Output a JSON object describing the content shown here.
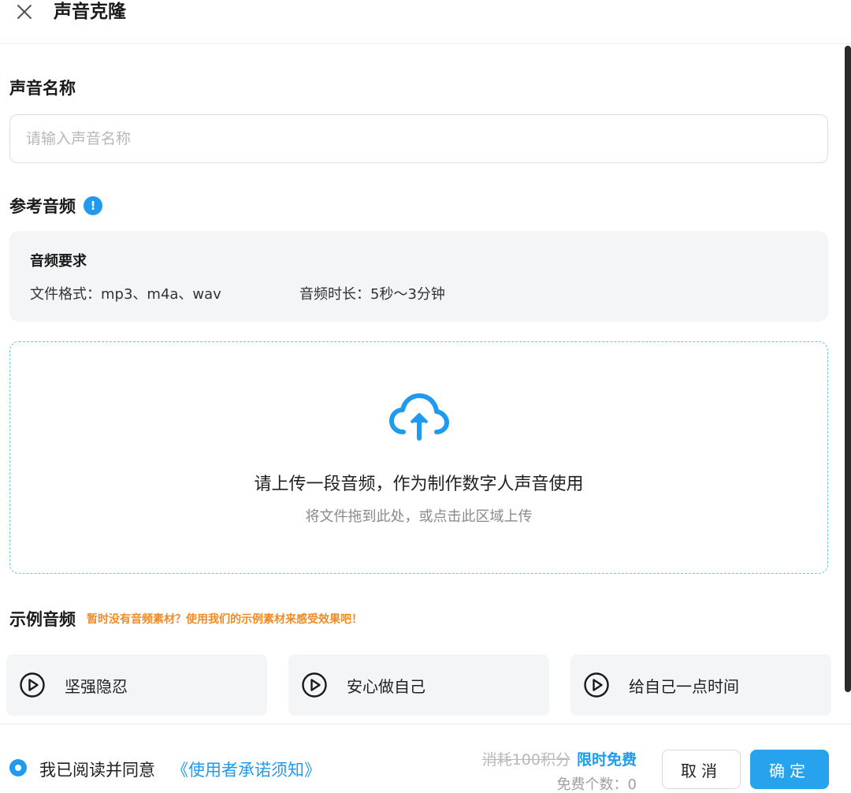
{
  "header": {
    "title": "声音克隆",
    "close_icon": "close-icon"
  },
  "voice_name": {
    "label": "声音名称",
    "placeholder": "请输入声音名称",
    "value": ""
  },
  "reference_audio": {
    "label": "参考音频",
    "info_icon": "info-icon",
    "info_glyph": "!",
    "requirements": {
      "title": "音频要求",
      "format": "文件格式：mp3、m4a、wav",
      "duration": "音频时长：5秒～3分钟"
    },
    "upload": {
      "icon": "cloud-upload-icon",
      "main_text": "请上传一段音频，作为制作数字人声音使用",
      "sub_text": "将文件拖到此处，或点击此区域上传"
    }
  },
  "examples": {
    "label": "示例音频",
    "hint": "暂时没有音频素材？使用我们的示例素材来感受效果吧！",
    "items": [
      {
        "name": "坚强隐忍",
        "icon": "play-icon"
      },
      {
        "name": "安心做自己",
        "icon": "play-icon"
      },
      {
        "name": "给自己一点时间",
        "icon": "play-icon"
      }
    ]
  },
  "footer": {
    "agree_checked": true,
    "agree_text": "我已阅读并同意",
    "agree_link": "《使用者承诺须知》",
    "cost_original": "消耗100积分",
    "cost_promo": "限时免费",
    "free_count": "免费个数：0",
    "cancel_label": "取消",
    "confirm_label": "确定"
  },
  "colors": {
    "accent": "#1e9bf0",
    "hint_orange": "#f08a24",
    "panel_bg": "#f4f5f7",
    "dashed_border": "#6cc2ea"
  }
}
